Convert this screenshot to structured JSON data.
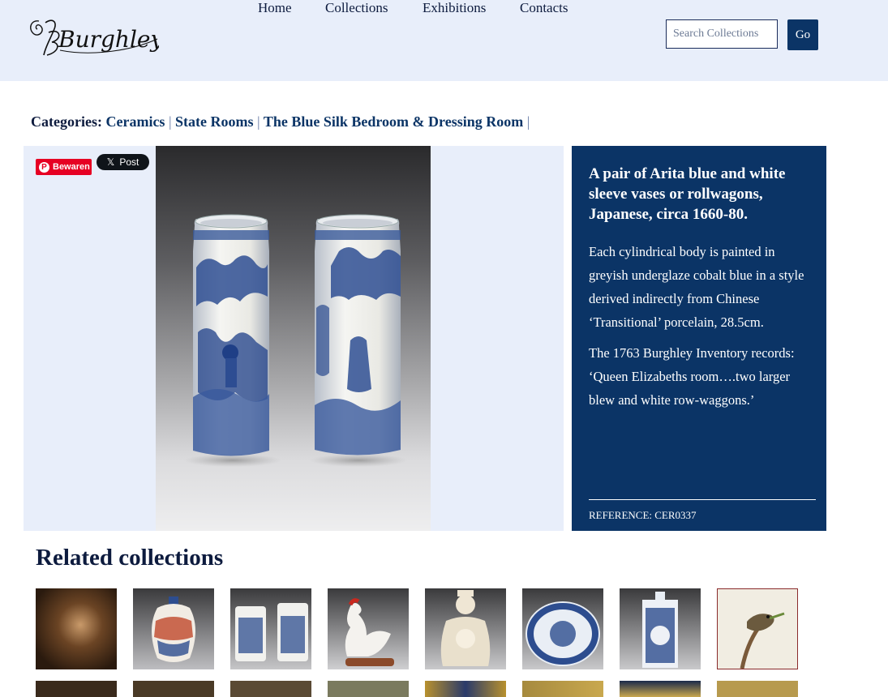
{
  "header": {
    "logo_text": "Burghley",
    "nav": [
      "Home",
      "Collections",
      "Exhibitions",
      "Contacts"
    ],
    "search_placeholder": "Search Collections",
    "go_label": "Go"
  },
  "categories": {
    "label": "Categories:",
    "items": [
      "Ceramics",
      "State Rooms",
      "The Blue Silk Bedroom & Dressing Room"
    ],
    "separator": "|"
  },
  "share": {
    "pinterest_label": "Bewaren",
    "x_label": "Post"
  },
  "item": {
    "title": "A pair of Arita blue and white sleeve vases or rollwagons, Japanese, circa 1660-80.",
    "description_1": "Each cylindrical body is painted in greyish underglaze cobalt blue in a style derived indirectly from Chinese ‘Transitional’ porcelain, 28.5cm.",
    "description_2": "The 1763 Burghley Inventory records: ‘Queen Elizabeths room….two larger blew and white row-waggons.’",
    "reference": "REFERENCE: CER0337"
  },
  "related": {
    "title": "Related collections",
    "thumbnails": [
      "painting-thumbnail",
      "imari-jar-thumbnail",
      "blue-white-vases-thumbnail",
      "porcelain-cockerel-thumbnail",
      "blanc-de-chine-figure-thumbnail",
      "blue-white-dish-thumbnail",
      "tea-caddy-thumbnail",
      "bird-painting-thumbnail"
    ]
  },
  "colors": {
    "header_bg": "#e8eefa",
    "navy": "#0b3466",
    "pinterest_red": "#e60023"
  }
}
